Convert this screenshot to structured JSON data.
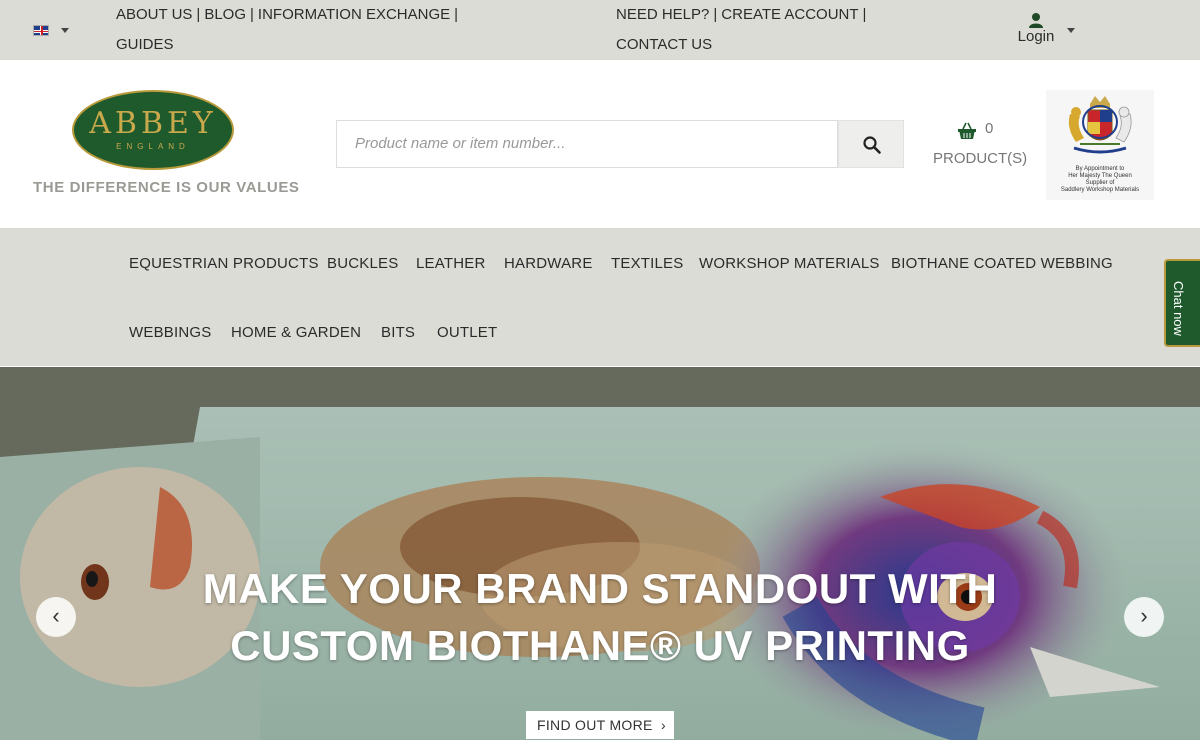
{
  "topbar": {
    "left_links": [
      "ABOUT US",
      "BLOG",
      "INFORMATION EXCHANGE",
      "GUIDES"
    ],
    "help_links": [
      "NEED HELP?",
      "CREATE ACCOUNT",
      "CONTACT US"
    ],
    "login_label": "Login"
  },
  "header": {
    "logo_name": "ABBEY",
    "logo_sub": "ENGLAND",
    "tagline": "THE DIFFERENCE IS OUR VALUES",
    "search_placeholder": "Product name or item number...",
    "cart_count": "0",
    "cart_label": "PRODUCT(S)",
    "warrant_text": [
      "By Appointment to",
      "Her Majesty The Queen",
      "Supplier of",
      "Saddlery Workshop Materials"
    ]
  },
  "nav": {
    "items": [
      "EQUESTRIAN PRODUCTS",
      "BUCKLES",
      "LEATHER",
      "HARDWARE",
      "TEXTILES",
      "WORKSHOP MATERIALS",
      "BIOTHANE COATED WEBBING",
      "WEBBINGS",
      "HOME & GARDEN",
      "BITS",
      "OUTLET"
    ]
  },
  "chat": {
    "label": "Chat now"
  },
  "hero": {
    "title_line1": "MAKE YOUR BRAND STANDOUT WITH",
    "title_line2": "CUSTOM BIOTHANE® UV PRINTING",
    "button_label": "FIND OUT MORE",
    "button_chevron": "›",
    "prev_glyph": "‹",
    "next_glyph": "›"
  },
  "colors": {
    "brand_green": "#1f5a2d",
    "brand_gold": "#c9a94b",
    "bar_grey": "#dcdcd6"
  }
}
